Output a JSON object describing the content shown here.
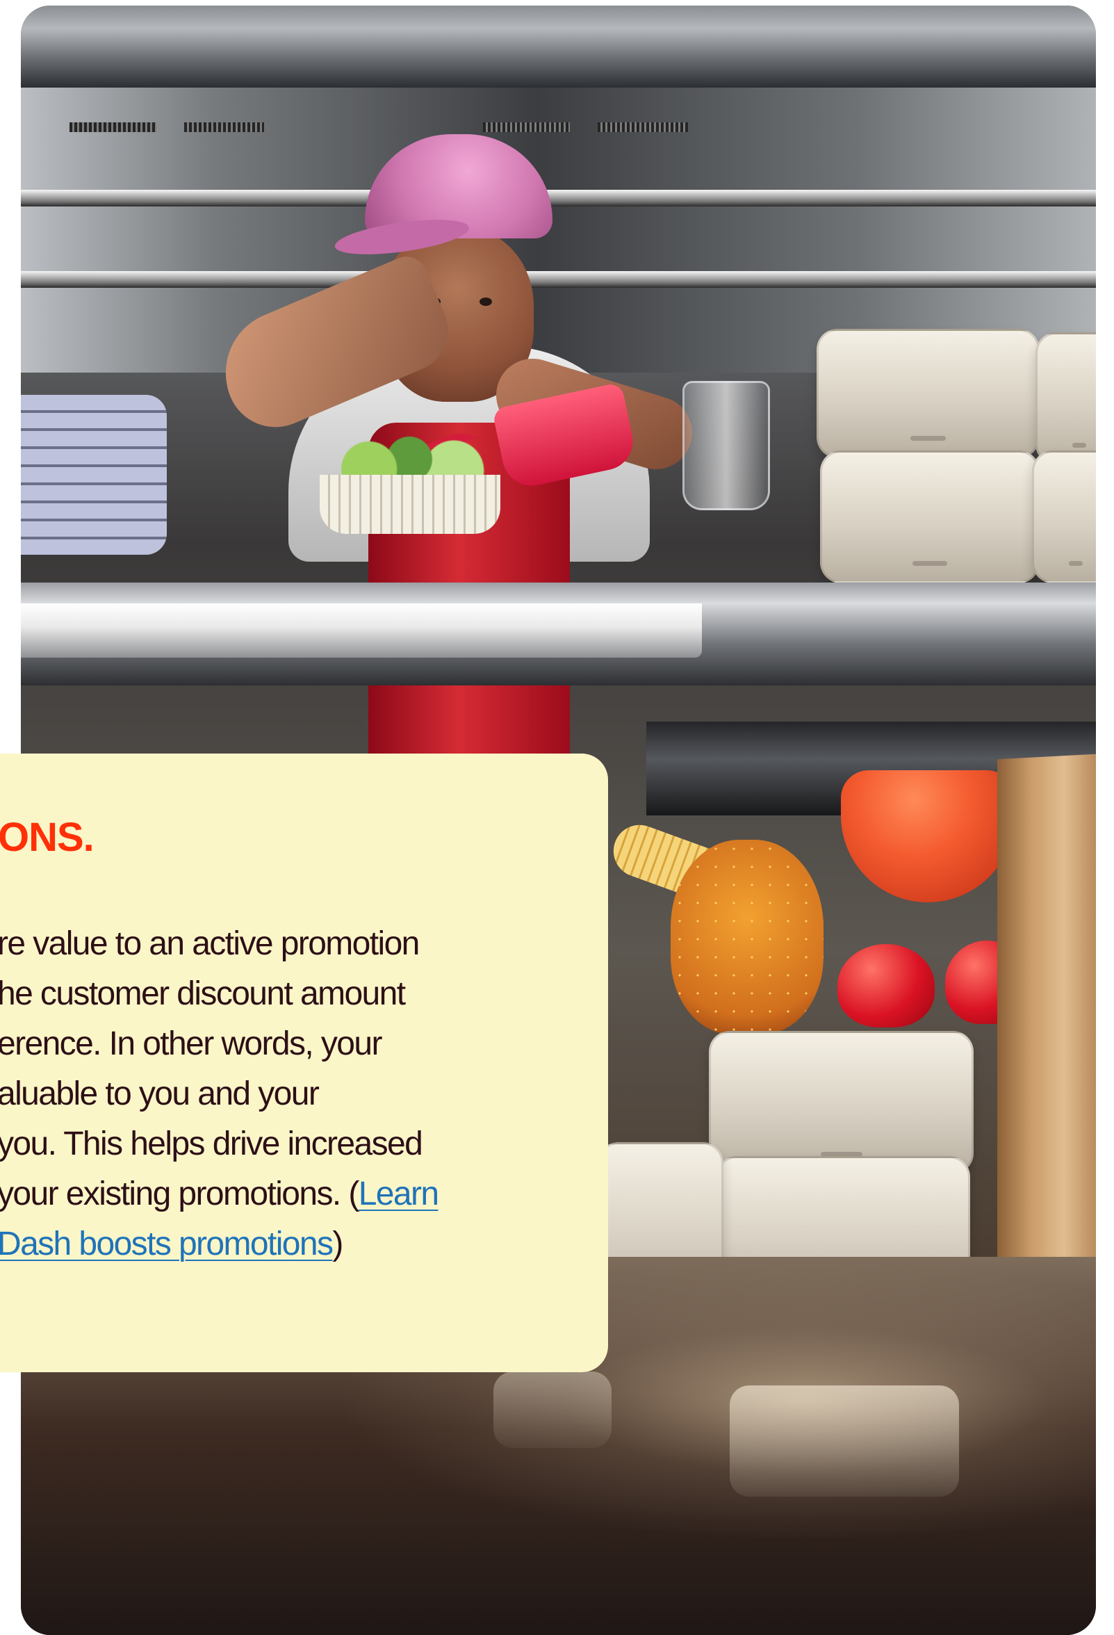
{
  "card": {
    "heading": "ONS.",
    "paragraph_lines": [
      "re value to an active promotion",
      "he customer discount amount",
      "erence. In other words, your",
      "aluable to you and your",
      "you. This helps drive increased",
      "your existing promotions. ("
    ],
    "link_first_line": "Learn",
    "link_second_line": "Dash boosts promotions",
    "closing_paren": ")"
  },
  "colors": {
    "card_background": "#faf6c8",
    "heading_color": "#ff3008",
    "body_text_color": "#2d0f16",
    "link_color": "#1f73b9"
  },
  "image": {
    "subject": "kitchen-photo"
  }
}
